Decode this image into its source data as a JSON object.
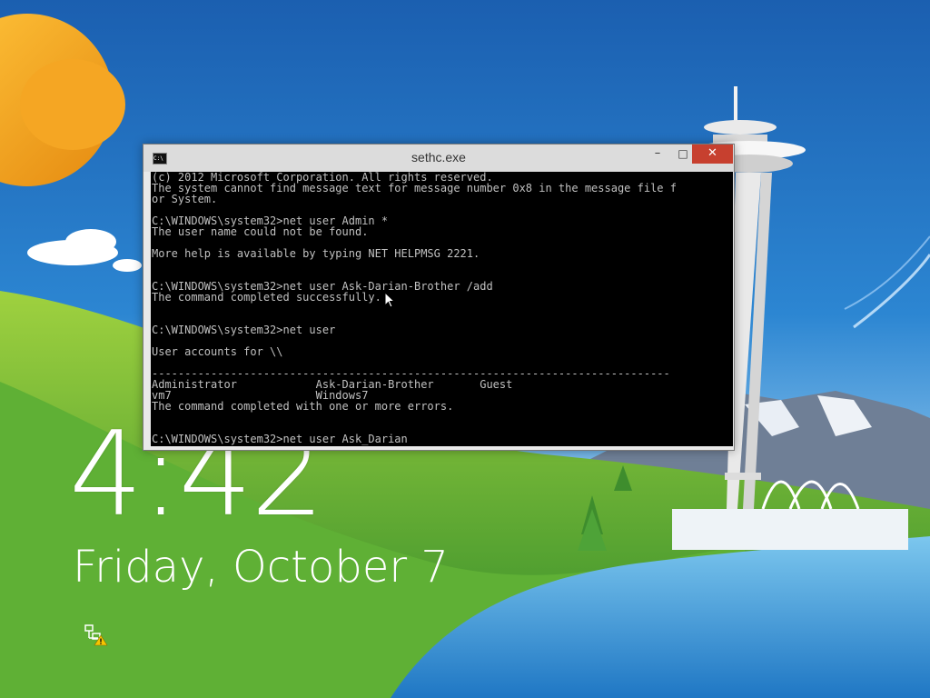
{
  "console": {
    "title": "sethc.exe",
    "icon_label": "C:\\",
    "buttons": {
      "minimize": "–",
      "maximize": "□",
      "close": "✕"
    },
    "lines": [
      "(c) 2012 Microsoft Corporation. All rights reserved.",
      "The system cannot find message text for message number 0x8 in the message file f",
      "or System.",
      "",
      "C:\\WINDOWS\\system32>net user Admin *",
      "The user name could not be found.",
      "",
      "More help is available by typing NET HELPMSG 2221.",
      "",
      "",
      "C:\\WINDOWS\\system32>net user Ask-Darian-Brother /add",
      "The command completed successfully.",
      "",
      "",
      "C:\\WINDOWS\\system32>net user",
      "",
      "User accounts for \\\\",
      "",
      "-------------------------------------------------------------------------------",
      "Administrator            Ask-Darian-Brother       Guest",
      "vm7                      Windows7",
      "The command completed with one or more errors.",
      "",
      "",
      "C:\\WINDOWS\\system32>net user Ask_Darian"
    ]
  },
  "lockscreen": {
    "time": "4:42",
    "date": "Friday, October 7",
    "network_status": "network-warning-icon"
  }
}
